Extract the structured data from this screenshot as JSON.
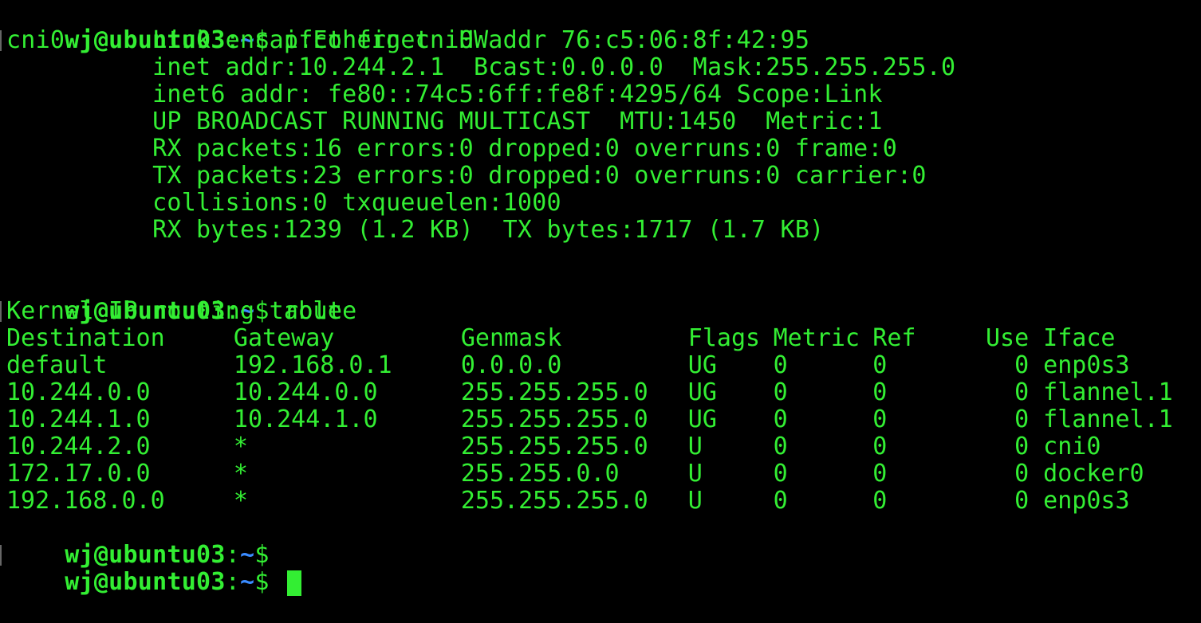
{
  "prompt": {
    "user_host": "wj@ubuntu03",
    "sep": ":",
    "path": "~",
    "symbol": "$"
  },
  "commands": [
    {
      "text": "ifconfig cni0"
    },
    {
      "text": "route"
    },
    {
      "text": ""
    },
    {
      "text": ""
    }
  ],
  "ifconfig_output": [
    "cni0      Link encap:Ethernet  HWaddr 76:c5:06:8f:42:95",
    "          inet addr:10.244.2.1  Bcast:0.0.0.0  Mask:255.255.255.0",
    "          inet6 addr: fe80::74c5:6ff:fe8f:4295/64 Scope:Link",
    "          UP BROADCAST RUNNING MULTICAST  MTU:1450  Metric:1",
    "          RX packets:16 errors:0 dropped:0 overruns:0 frame:0",
    "          TX packets:23 errors:0 dropped:0 overruns:0 carrier:0",
    "          collisions:0 txqueuelen:1000",
    "          RX bytes:1239 (1.2 KB)  TX bytes:1717 (1.7 KB)",
    ""
  ],
  "route_output": {
    "title": "Kernel IP routing table",
    "headers": [
      "Destination",
      "Gateway",
      "Genmask",
      "Flags",
      "Metric",
      "Ref",
      "Use",
      "Iface"
    ],
    "rows": [
      [
        "default",
        "192.168.0.1",
        "0.0.0.0",
        "UG",
        "0",
        "0",
        "0",
        "enp0s3"
      ],
      [
        "10.244.0.0",
        "10.244.0.0",
        "255.255.255.0",
        "UG",
        "0",
        "0",
        "0",
        "flannel.1"
      ],
      [
        "10.244.1.0",
        "10.244.1.0",
        "255.255.255.0",
        "UG",
        "0",
        "0",
        "0",
        "flannel.1"
      ],
      [
        "10.244.2.0",
        "*",
        "255.255.255.0",
        "U",
        "0",
        "0",
        "0",
        "cni0"
      ],
      [
        "172.17.0.0",
        "*",
        "255.255.0.0",
        "U",
        "0",
        "0",
        "0",
        "docker0"
      ],
      [
        "192.168.0.0",
        "*",
        "255.255.255.0",
        "U",
        "0",
        "0",
        "0",
        "enp0s3"
      ]
    ]
  },
  "colors": {
    "background": "#000000",
    "text": "#33ee33",
    "path": "#3a8bff"
  }
}
